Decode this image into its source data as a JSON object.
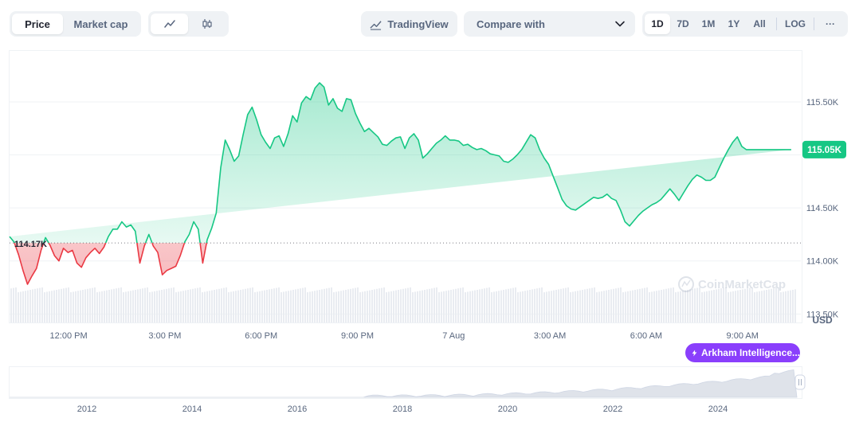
{
  "toolbar": {
    "price_label": "Price",
    "market_cap_label": "Market cap",
    "tradingview_label": "TradingView",
    "compare_label": "Compare with",
    "ranges": [
      "1D",
      "7D",
      "1M",
      "1Y",
      "All"
    ],
    "active_range": "1D",
    "log_label": "LOG",
    "more_label": "···"
  },
  "watermark": "CoinMarketCap",
  "currency_label": "USD",
  "arkham_label": "Arkham Intelligence...",
  "colors": {
    "up": "#16c784",
    "down": "#ea3943",
    "accent": "#8a3ffc"
  },
  "chart_data": {
    "type": "area",
    "baseline": 114.17,
    "baseline_label": "114.17K",
    "current_label": "115.05K",
    "current_value": 115.05,
    "y_ticks": [
      "115.50K",
      "115.00K",
      "114.50K",
      "114.00K",
      "113.50K"
    ],
    "ylim": [
      113.42,
      115.98
    ],
    "x_tick_labels": [
      "12:00 PM",
      "3:00 PM",
      "6:00 PM",
      "9:00 PM",
      "7 Aug",
      "3:00 AM",
      "6:00 AM",
      "9:00 AM"
    ],
    "x_hours": [
      0,
      1.5,
      3,
      4.5,
      6,
      7.5,
      9,
      10.5
    ],
    "xlim": [
      -0.92,
      11.41
    ],
    "series_hours": [
      -0.92,
      -0.85,
      -0.78,
      -0.71,
      -0.64,
      -0.57,
      -0.5,
      -0.43,
      -0.36,
      -0.29,
      -0.22,
      -0.15,
      -0.08,
      -0.01,
      0.06,
      0.13,
      0.2,
      0.27,
      0.34,
      0.41,
      0.48,
      0.55,
      0.62,
      0.69,
      0.76,
      0.83,
      0.9,
      0.97,
      1.04,
      1.11,
      1.18,
      1.25,
      1.32,
      1.39,
      1.46,
      1.53,
      1.6,
      1.67,
      1.74,
      1.81,
      1.88,
      1.95,
      2.02,
      2.09,
      2.16,
      2.23,
      2.3,
      2.37,
      2.44,
      2.51,
      2.58,
      2.65,
      2.72,
      2.79,
      2.86,
      2.93,
      3.0,
      3.07,
      3.14,
      3.21,
      3.28,
      3.35,
      3.42,
      3.49,
      3.56,
      3.63,
      3.7,
      3.77,
      3.84,
      3.91,
      3.98,
      4.05,
      4.12,
      4.19,
      4.26,
      4.33,
      4.4,
      4.47,
      4.54,
      4.61,
      4.68,
      4.75,
      4.82,
      4.89,
      4.96,
      5.03,
      5.1,
      5.17,
      5.24,
      5.31,
      5.38,
      5.45,
      5.52,
      5.59,
      5.66,
      5.73,
      5.8,
      5.87,
      5.94,
      6.01,
      6.08,
      6.15,
      6.22,
      6.29,
      6.36,
      6.43,
      6.5,
      6.57,
      6.64,
      6.71,
      6.78,
      6.85,
      6.92,
      6.99,
      7.06,
      7.13,
      7.2,
      7.27,
      7.34,
      7.41,
      7.48,
      7.55,
      7.62,
      7.69,
      7.76,
      7.83,
      7.9,
      7.97,
      8.04,
      8.11,
      8.18,
      8.25,
      8.32,
      8.39,
      8.46,
      8.53,
      8.6,
      8.67,
      8.74,
      8.81,
      8.88,
      8.95,
      9.02,
      9.09,
      9.16,
      9.23,
      9.3,
      9.37,
      9.44,
      9.51,
      9.58,
      9.65,
      9.72,
      9.79,
      9.86,
      9.93,
      10.0,
      10.07,
      10.14,
      10.21,
      10.28,
      10.35,
      10.42,
      10.49,
      10.56,
      10.63,
      10.7,
      10.77,
      10.84,
      10.91,
      10.98,
      11.05,
      11.12,
      11.19,
      11.26,
      11.33,
      11.41
    ],
    "series_values": [
      114.23,
      114.18,
      114.06,
      113.91,
      113.78,
      113.86,
      113.93,
      114.1,
      114.22,
      114.15,
      114.05,
      114.0,
      114.12,
      114.08,
      114.1,
      113.98,
      113.94,
      114.03,
      114.08,
      114.12,
      114.07,
      114.13,
      114.23,
      114.3,
      114.3,
      114.37,
      114.32,
      114.34,
      114.28,
      113.98,
      114.14,
      114.25,
      114.14,
      114.08,
      113.87,
      113.91,
      113.93,
      113.95,
      114.05,
      114.18,
      114.25,
      114.37,
      114.3,
      113.98,
      114.2,
      114.31,
      114.45,
      114.88,
      115.14,
      115.05,
      114.94,
      114.99,
      115.19,
      115.38,
      115.45,
      115.33,
      115.19,
      115.12,
      115.06,
      115.16,
      115.18,
      115.08,
      115.2,
      115.37,
      115.31,
      115.49,
      115.55,
      115.52,
      115.63,
      115.68,
      115.64,
      115.47,
      115.53,
      115.44,
      115.41,
      115.53,
      115.52,
      115.39,
      115.3,
      115.22,
      115.25,
      115.21,
      115.17,
      115.1,
      115.09,
      115.13,
      115.16,
      115.17,
      115.06,
      115.16,
      115.2,
      115.14,
      114.97,
      115.01,
      115.06,
      115.11,
      115.14,
      115.18,
      115.14,
      115.14,
      115.13,
      115.09,
      115.1,
      115.07,
      115.05,
      115.06,
      115.04,
      115.01,
      115.0,
      114.99,
      114.94,
      114.93,
      114.96,
      115.0,
      115.05,
      115.12,
      115.19,
      115.16,
      115.05,
      114.97,
      114.91,
      114.8,
      114.69,
      114.58,
      114.52,
      114.49,
      114.48,
      114.51,
      114.54,
      114.57,
      114.6,
      114.59,
      114.6,
      114.63,
      114.59,
      114.57,
      114.48,
      114.37,
      114.33,
      114.38,
      114.43,
      114.47,
      114.5,
      114.53,
      114.55,
      114.58,
      114.63,
      114.68,
      114.63,
      114.57,
      114.64,
      114.71,
      114.77,
      114.81,
      114.79,
      114.76,
      114.76,
      114.79,
      114.88,
      114.97,
      115.05,
      115.12,
      115.17,
      115.08,
      115.05,
      115.05,
      115.05,
      115.05,
      115.05,
      115.05,
      115.05,
      115.05,
      115.05,
      115.05,
      115.05
    ],
    "volume_note": "",
    "overview_x_labels": [
      "2012",
      "2014",
      "2016",
      "2018",
      "2020",
      "2022",
      "2024"
    ]
  }
}
